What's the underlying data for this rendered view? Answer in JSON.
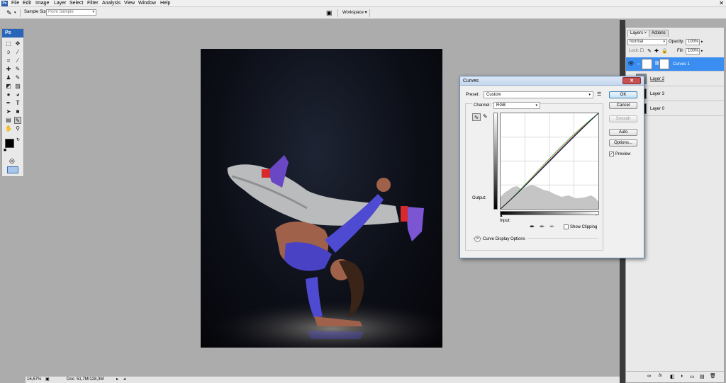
{
  "menubar": {
    "logo": "Ps",
    "items": [
      "File",
      "Edit",
      "Image",
      "Layer",
      "Select",
      "Filter",
      "Analysis",
      "View",
      "Window",
      "Help"
    ],
    "close_glyph": "✕"
  },
  "options_bar": {
    "sample_size_label": "Sample Size:",
    "sample_size_value": "Point Sample",
    "workspace_label": "Workspace ▾"
  },
  "tools": {
    "header": "Ps"
  },
  "status_bar": {
    "zoom": "16,67%",
    "doc": "Doc: 51,7M/128,3M"
  },
  "layers_panel": {
    "tabs": [
      "Layers ×",
      "Actions"
    ],
    "blend_mode": "Normal",
    "opacity_label": "Opacity:",
    "opacity_value": "100%",
    "lock_label": "Lock:",
    "fill_label": "Fill:",
    "fill_value": "100%",
    "layers": [
      {
        "name": "Curves 1",
        "selected": true
      },
      {
        "name": "Layer 2",
        "selected": false
      },
      {
        "name": "Layer 3",
        "selected": false
      },
      {
        "name": "Layer 0",
        "selected": false
      }
    ],
    "footer_icons": [
      "∞",
      "fx",
      "◧",
      "◑",
      "▭",
      "▤",
      "🗑"
    ]
  },
  "curves_dialog": {
    "title": "Curves",
    "close_glyph": "✕",
    "preset_label": "Preset:",
    "preset_value": "Custom",
    "channel_label": "Channel:",
    "channel_value": "RGB",
    "output_label": "Output:",
    "input_label": "Input:",
    "show_clipping_label": "Show Clipping",
    "curve_display_options_label": "Curve Display Options",
    "buttons": {
      "ok": "OK",
      "cancel": "Cancel",
      "smooth": "Smooth",
      "auto": "Auto",
      "options": "Options..."
    },
    "preview_label": "Preview",
    "preview_checked": true,
    "show_clipping_checked": false,
    "colors": {
      "red": "#d43b3b",
      "green": "#3fae4a",
      "blue": "#3b5fd4",
      "rgb": "#111111"
    }
  }
}
